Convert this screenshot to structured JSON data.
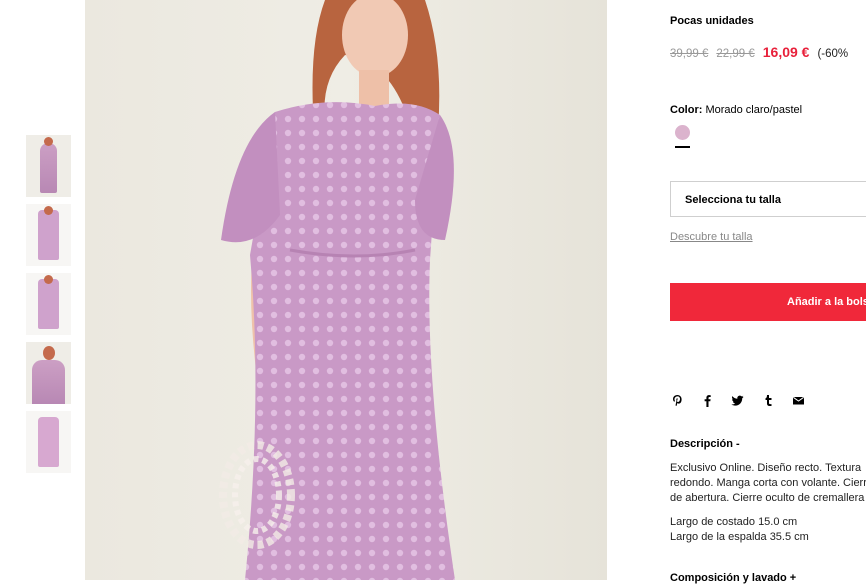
{
  "product": {
    "stock_label": "Pocas unidades",
    "price_original_1": "39,99 €",
    "price_original_2": "22,99 €",
    "price_current": "16,09 €",
    "discount": "(-60%",
    "color_label": "Color:",
    "color_value": "Morado claro/pastel",
    "size_placeholder": "Selecciona tu talla",
    "size_guide": "Descubre tu talla",
    "add_to_bag": "Añadir a la bolsa",
    "description_title": "Descripción -",
    "description_lines": [
      "Exclusivo Online. Diseño recto. Textura",
      "redondo. Manga corta con volante. Cierre",
      "de abertura. Cierre oculto de cremallera"
    ],
    "measurement_lines": [
      "Largo de costado 15.0 cm",
      "Largo de la espalda 35.5 cm"
    ],
    "composition_title": "Composición y lavado +"
  },
  "share_icons": [
    "pinterest-icon",
    "facebook-icon",
    "twitter-icon",
    "tumblr-icon",
    "email-icon"
  ],
  "thumbnails": [
    "front-view",
    "full-length",
    "side-view",
    "detail-view",
    "flat-view"
  ],
  "colors": {
    "accent": "#f0283a",
    "sale_price": "#e8203a",
    "swatch": "#dbb3cd"
  }
}
